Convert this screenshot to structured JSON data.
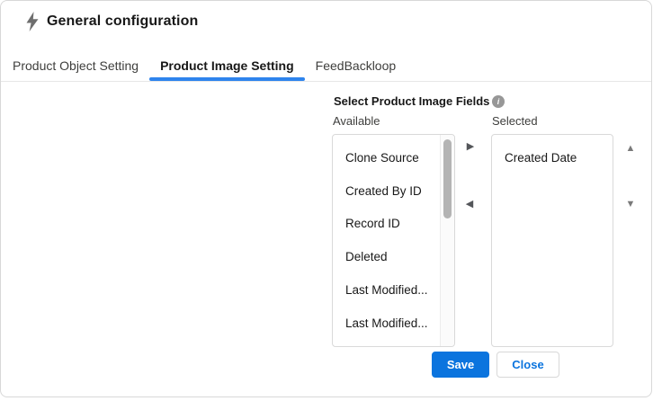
{
  "header": {
    "title": "General configuration"
  },
  "tabs": [
    {
      "label": "Product Object Setting",
      "active": false
    },
    {
      "label": "Product Image Setting",
      "active": true
    },
    {
      "label": "FeedBackloop",
      "active": false
    }
  ],
  "form": {
    "section_label": "Select Product Image Fields",
    "available": {
      "label": "Available",
      "items": [
        "Clone Source",
        "Created By ID",
        "Record ID",
        "Deleted",
        "Last Modified...",
        "Last Modified..."
      ]
    },
    "selected": {
      "label": "Selected",
      "items": [
        "Created Date"
      ]
    }
  },
  "icons": {
    "info_glyph": "i",
    "right_arrow": "▶",
    "left_arrow": "◀",
    "up_arrow": "▲",
    "down_arrow": "▼"
  },
  "buttons": {
    "save": "Save",
    "close": "Close"
  },
  "colors": {
    "accent_blue": "#0b74de",
    "tab_underline": "#2e84ed",
    "icon_gray": "#6e6e6e"
  }
}
